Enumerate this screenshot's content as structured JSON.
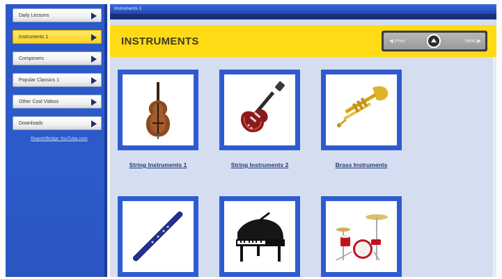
{
  "sidebar": {
    "items": [
      {
        "label": "Daily Lessons"
      },
      {
        "label": "Instruments 1"
      },
      {
        "label": "Composers"
      },
      {
        "label": "Popular Classics 1"
      },
      {
        "label": "Other Cool Videos"
      },
      {
        "label": "Downloads"
      }
    ],
    "link": "Report/Bridge YouTube.com"
  },
  "main": {
    "tab_title": "Instruments 1",
    "header_title": "INSTRUMENTS",
    "pager": {
      "prev_label": "Prev",
      "next_label": "Next"
    },
    "tiles": [
      {
        "caption": "String Instruments 1",
        "icon": "double-bass-icon"
      },
      {
        "caption": "String Instruments 2",
        "icon": "electric-guitar-icon"
      },
      {
        "caption": "Brass Instruments",
        "icon": "trumpet-icon"
      },
      {
        "caption": "",
        "icon": "clarinet-icon"
      },
      {
        "caption": "",
        "icon": "grand-piano-icon"
      },
      {
        "caption": "",
        "icon": "drum-kit-icon"
      }
    ]
  },
  "colors": {
    "sidebar_blue": "#2c58c8",
    "header_yellow": "#ffdb16",
    "tile_border": "#2f5bd0",
    "active_item": "#ffd21f"
  }
}
